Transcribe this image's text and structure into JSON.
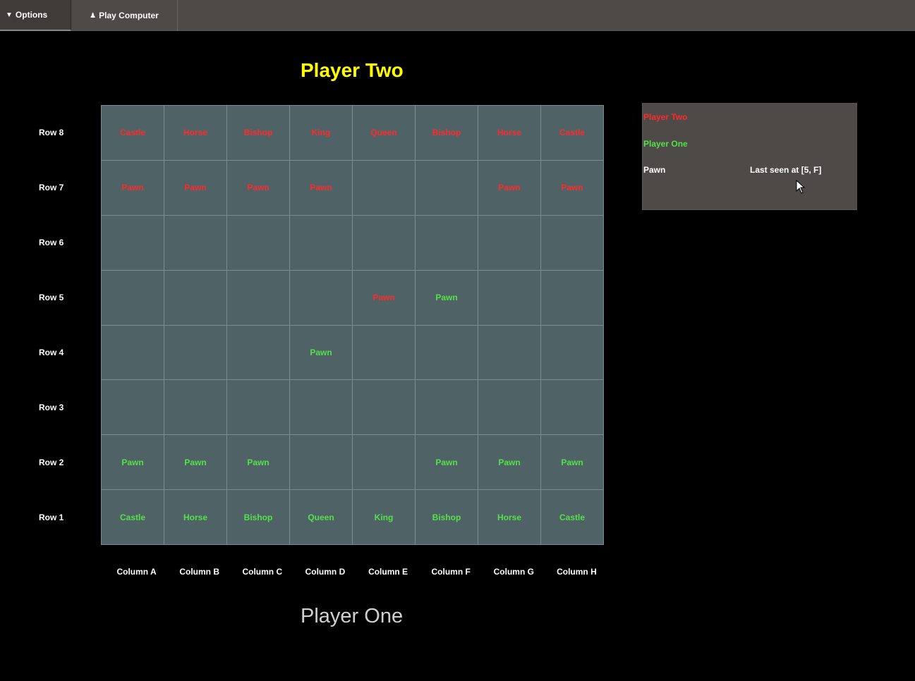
{
  "toolbar": {
    "options_label": "Options",
    "options_icon": "triangle-down-icon",
    "play_label": "Play Computer",
    "play_icon": "pawn-icon"
  },
  "titles": {
    "player_two": "Player Two",
    "player_one": "Player One"
  },
  "rows": [
    "Row 8",
    "Row 7",
    "Row 6",
    "Row 5",
    "Row 4",
    "Row 3",
    "Row 2",
    "Row 1"
  ],
  "columns": [
    "Column A",
    "Column B",
    "Column C",
    "Column D",
    "Column E",
    "Column F",
    "Column G",
    "Column H"
  ],
  "colors": {
    "player_two": "#ff2a2a",
    "player_one": "#55e04a",
    "title_player_two": "#ffff00",
    "board_cell": "#4f6367"
  },
  "board": [
    [
      {
        "piece": "Castle",
        "owner": "p2"
      },
      {
        "piece": "Horse",
        "owner": "p2"
      },
      {
        "piece": "Bishop",
        "owner": "p2"
      },
      {
        "piece": "King",
        "owner": "p2"
      },
      {
        "piece": "Queen",
        "owner": "p2"
      },
      {
        "piece": "Bishop",
        "owner": "p2"
      },
      {
        "piece": "Horse",
        "owner": "p2"
      },
      {
        "piece": "Castle",
        "owner": "p2"
      }
    ],
    [
      {
        "piece": "Pawn",
        "owner": "p2"
      },
      {
        "piece": "Pawn",
        "owner": "p2"
      },
      {
        "piece": "Pawn",
        "owner": "p2"
      },
      {
        "piece": "Pawn",
        "owner": "p2"
      },
      {
        "piece": "",
        "owner": ""
      },
      {
        "piece": "",
        "owner": ""
      },
      {
        "piece": "Pawn",
        "owner": "p2"
      },
      {
        "piece": "Pawn",
        "owner": "p2"
      }
    ],
    [
      {
        "piece": "",
        "owner": ""
      },
      {
        "piece": "",
        "owner": ""
      },
      {
        "piece": "",
        "owner": ""
      },
      {
        "piece": "",
        "owner": ""
      },
      {
        "piece": "",
        "owner": ""
      },
      {
        "piece": "",
        "owner": ""
      },
      {
        "piece": "",
        "owner": ""
      },
      {
        "piece": "",
        "owner": ""
      }
    ],
    [
      {
        "piece": "",
        "owner": ""
      },
      {
        "piece": "",
        "owner": ""
      },
      {
        "piece": "",
        "owner": ""
      },
      {
        "piece": "",
        "owner": ""
      },
      {
        "piece": "Pawn",
        "owner": "p2"
      },
      {
        "piece": "Pawn",
        "owner": "p1"
      },
      {
        "piece": "",
        "owner": ""
      },
      {
        "piece": "",
        "owner": ""
      }
    ],
    [
      {
        "piece": "",
        "owner": ""
      },
      {
        "piece": "",
        "owner": ""
      },
      {
        "piece": "",
        "owner": ""
      },
      {
        "piece": "Pawn",
        "owner": "p1"
      },
      {
        "piece": "",
        "owner": ""
      },
      {
        "piece": "",
        "owner": ""
      },
      {
        "piece": "",
        "owner": ""
      },
      {
        "piece": "",
        "owner": ""
      }
    ],
    [
      {
        "piece": "",
        "owner": ""
      },
      {
        "piece": "",
        "owner": ""
      },
      {
        "piece": "",
        "owner": ""
      },
      {
        "piece": "",
        "owner": ""
      },
      {
        "piece": "",
        "owner": ""
      },
      {
        "piece": "",
        "owner": ""
      },
      {
        "piece": "",
        "owner": ""
      },
      {
        "piece": "",
        "owner": ""
      }
    ],
    [
      {
        "piece": "Pawn",
        "owner": "p1"
      },
      {
        "piece": "Pawn",
        "owner": "p1"
      },
      {
        "piece": "Pawn",
        "owner": "p1"
      },
      {
        "piece": "",
        "owner": ""
      },
      {
        "piece": "",
        "owner": ""
      },
      {
        "piece": "Pawn",
        "owner": "p1"
      },
      {
        "piece": "Pawn",
        "owner": "p1"
      },
      {
        "piece": "Pawn",
        "owner": "p1"
      }
    ],
    [
      {
        "piece": "Castle",
        "owner": "p1"
      },
      {
        "piece": "Horse",
        "owner": "p1"
      },
      {
        "piece": "Bishop",
        "owner": "p1"
      },
      {
        "piece": "Queen",
        "owner": "p1"
      },
      {
        "piece": "King",
        "owner": "p1"
      },
      {
        "piece": "Bishop",
        "owner": "p1"
      },
      {
        "piece": "Horse",
        "owner": "p1"
      },
      {
        "piece": "Castle",
        "owner": "p1"
      }
    ]
  ],
  "info_panel": {
    "player_two": "Player Two",
    "player_one": "Player One",
    "piece": "Pawn",
    "last_seen": "Last seen at [5, F]"
  },
  "cursor_icon": "mouse-pointer-icon"
}
